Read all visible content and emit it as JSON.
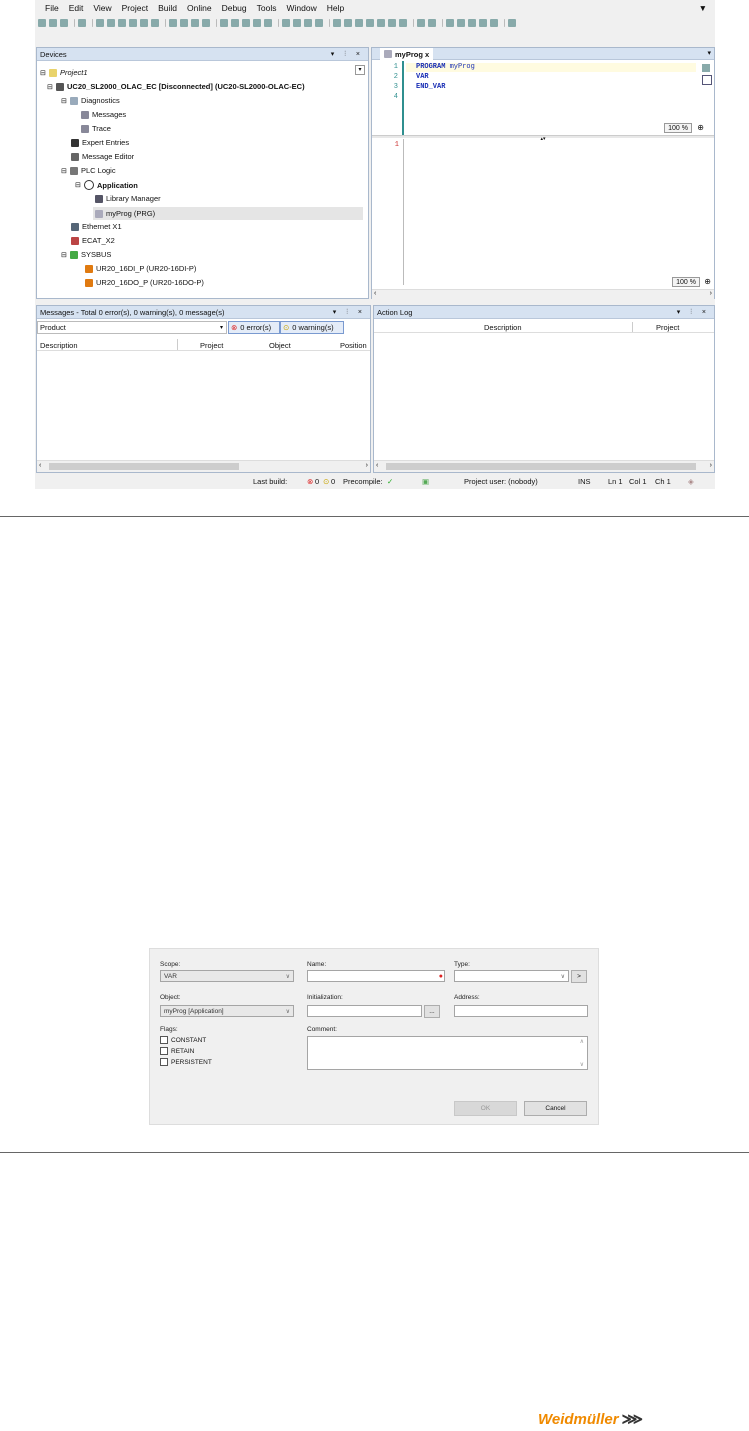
{
  "menu": [
    "File",
    "Edit",
    "View",
    "Project",
    "Build",
    "Online",
    "Debug",
    "Tools",
    "Window",
    "Help"
  ],
  "devices": {
    "title": "Devices",
    "controls": "▾ ⫶ ×",
    "tree": [
      {
        "label": "Project1",
        "italic": true
      },
      {
        "label": "UC20_SL2000_OLAC_EC [Disconnected] (UC20-SL2000-OLAC-EC)",
        "bold": true
      },
      {
        "label": "Diagnostics"
      },
      {
        "label": "Messages"
      },
      {
        "label": "Trace"
      },
      {
        "label": "Expert Entries"
      },
      {
        "label": "Message Editor"
      },
      {
        "label": "PLC Logic"
      },
      {
        "label": "Application",
        "bold": true
      },
      {
        "label": "Library Manager"
      },
      {
        "label": "myProg (PRG)"
      },
      {
        "label": "Ethernet X1"
      },
      {
        "label": "ECAT_X2"
      },
      {
        "label": "SYSBUS"
      },
      {
        "label": "UR20_16DI_P (UR20-16DI-P)"
      },
      {
        "label": "UR20_16DO_P (UR20-16DO-P)"
      }
    ]
  },
  "editor": {
    "tab": "myProg",
    "tab_close": "x",
    "lines": [
      "PROGRAM myProg",
      "VAR",
      "END_VAR",
      ""
    ],
    "line_numbers": [
      "1",
      "2",
      "3",
      "4"
    ],
    "zoom_top": "100 %",
    "impl_line": "1",
    "zoom_bottom": "100 %"
  },
  "messages": {
    "title": "Messages - Total 0 error(s), 0 warning(s), 0 message(s)",
    "filter": "Product",
    "errors": "0 error(s)",
    "warnings": "0 warning(s)",
    "columns": [
      "Description",
      "Project",
      "Object",
      "Position"
    ]
  },
  "action_log": {
    "title": "Action Log",
    "columns": [
      "Description",
      "Project"
    ]
  },
  "status": {
    "last_build": "Last build:",
    "err_count": "0",
    "warn_count": "0",
    "precompile": "Precompile:",
    "project_user": "Project user: (nobody)",
    "ins": "INS",
    "ln": "Ln 1",
    "col": "Col 1",
    "ch": "Ch 1"
  },
  "dialog": {
    "scope_label": "Scope:",
    "scope_value": "VAR",
    "name_label": "Name:",
    "type_label": "Type:",
    "type_btn": ">",
    "object_label": "Object:",
    "object_value": "myProg [Application]",
    "init_label": "Initialization:",
    "init_btn": "...",
    "address_label": "Address:",
    "flags_label": "Flags:",
    "flags": [
      "CONSTANT",
      "RETAIN",
      "PERSISTENT"
    ],
    "comment_label": "Comment:",
    "ok": "OK",
    "cancel": "Cancel"
  },
  "brand": "Weidmüller"
}
